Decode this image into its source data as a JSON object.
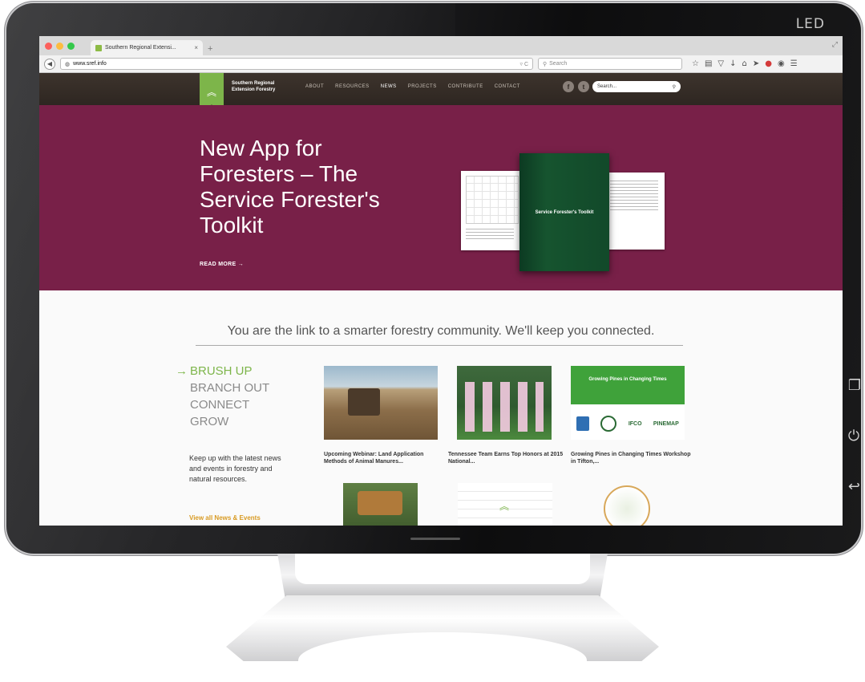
{
  "monitor": {
    "brand_label": "LED"
  },
  "browser": {
    "tab_title": "Southern Regional Extensi...",
    "url": "www.sref.info",
    "search_placeholder": "Search",
    "window_controls_colors": [
      "#fc605c",
      "#fdbc40",
      "#34c84a"
    ]
  },
  "site": {
    "name": "Southern Regional Extension Forestry",
    "nav": [
      "ABOUT",
      "RESOURCES",
      "NEWS",
      "PROJECTS",
      "CONTRIBUTE",
      "CONTACT"
    ],
    "search_placeholder": "Search...",
    "accent": "#7db54a",
    "hero": {
      "background": "#782048",
      "title": "New App for Foresters – The Service Forester's Toolkit",
      "cta": "READ MORE →",
      "book_title": "Service Forester's Toolkit"
    },
    "tagline": "You are the link to a smarter forestry community. We'll keep you connected.",
    "topics": [
      "BRUSH UP",
      "BRANCH OUT",
      "CONNECT",
      "GROW"
    ],
    "topic_arrow": "→",
    "intro": "Keep up with the latest news and events in forestry and natural resources.",
    "view_all": "View all News & Events",
    "cards": [
      {
        "title": "Upcoming Webinar: Land Application Methods of Animal Manures..."
      },
      {
        "title": "Tennessee Team Earns Top Honors at 2015 National..."
      },
      {
        "title": "Growing Pines in Changing Times Workshop in Tifton,...",
        "banner": "Growing Pines in Changing Times",
        "logo_text": "PINEMAP",
        "logo_text_2": "IFCO"
      }
    ]
  }
}
